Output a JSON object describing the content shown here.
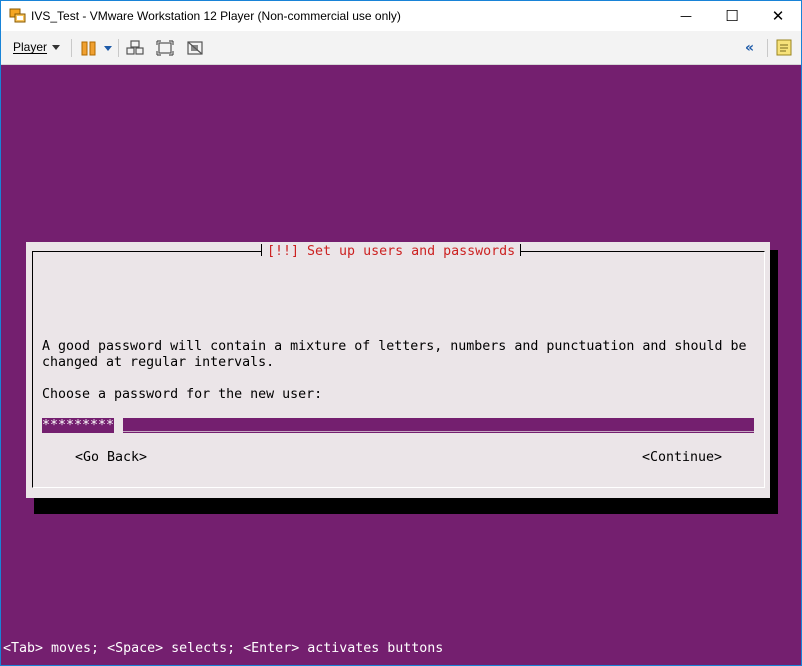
{
  "window": {
    "title": "IVS_Test - VMware Workstation 12 Player (Non-commercial use only)",
    "controls": {
      "minimize": "—",
      "maximize": "☐",
      "close": "✕"
    }
  },
  "toolbar": {
    "player_menu": "Player",
    "icons": [
      "pause-icon",
      "send-ctrl-alt-del-icon",
      "fullscreen-icon",
      "unity-icon",
      "unity-collapse-icon",
      "notes-icon"
    ],
    "unity_glyph": "«"
  },
  "installer": {
    "dialog_title": "[!!] Set up users and passwords",
    "message_line1": "A good password will contain a mixture of letters, numbers and punctuation and should be",
    "message_line2": "changed at regular intervals.",
    "prompt": "Choose a password for the new user:",
    "password_value": "*********",
    "go_back_button": "<Go Back>",
    "continue_button": "<Continue>",
    "status_line": "<Tab> moves; <Space> selects; <Enter> activates buttons"
  },
  "colors": {
    "console_background": "#741f6f",
    "dialog_background": "#ebe5e8",
    "dialog_title": "#cc2222",
    "accent": "#1d5aa8"
  }
}
